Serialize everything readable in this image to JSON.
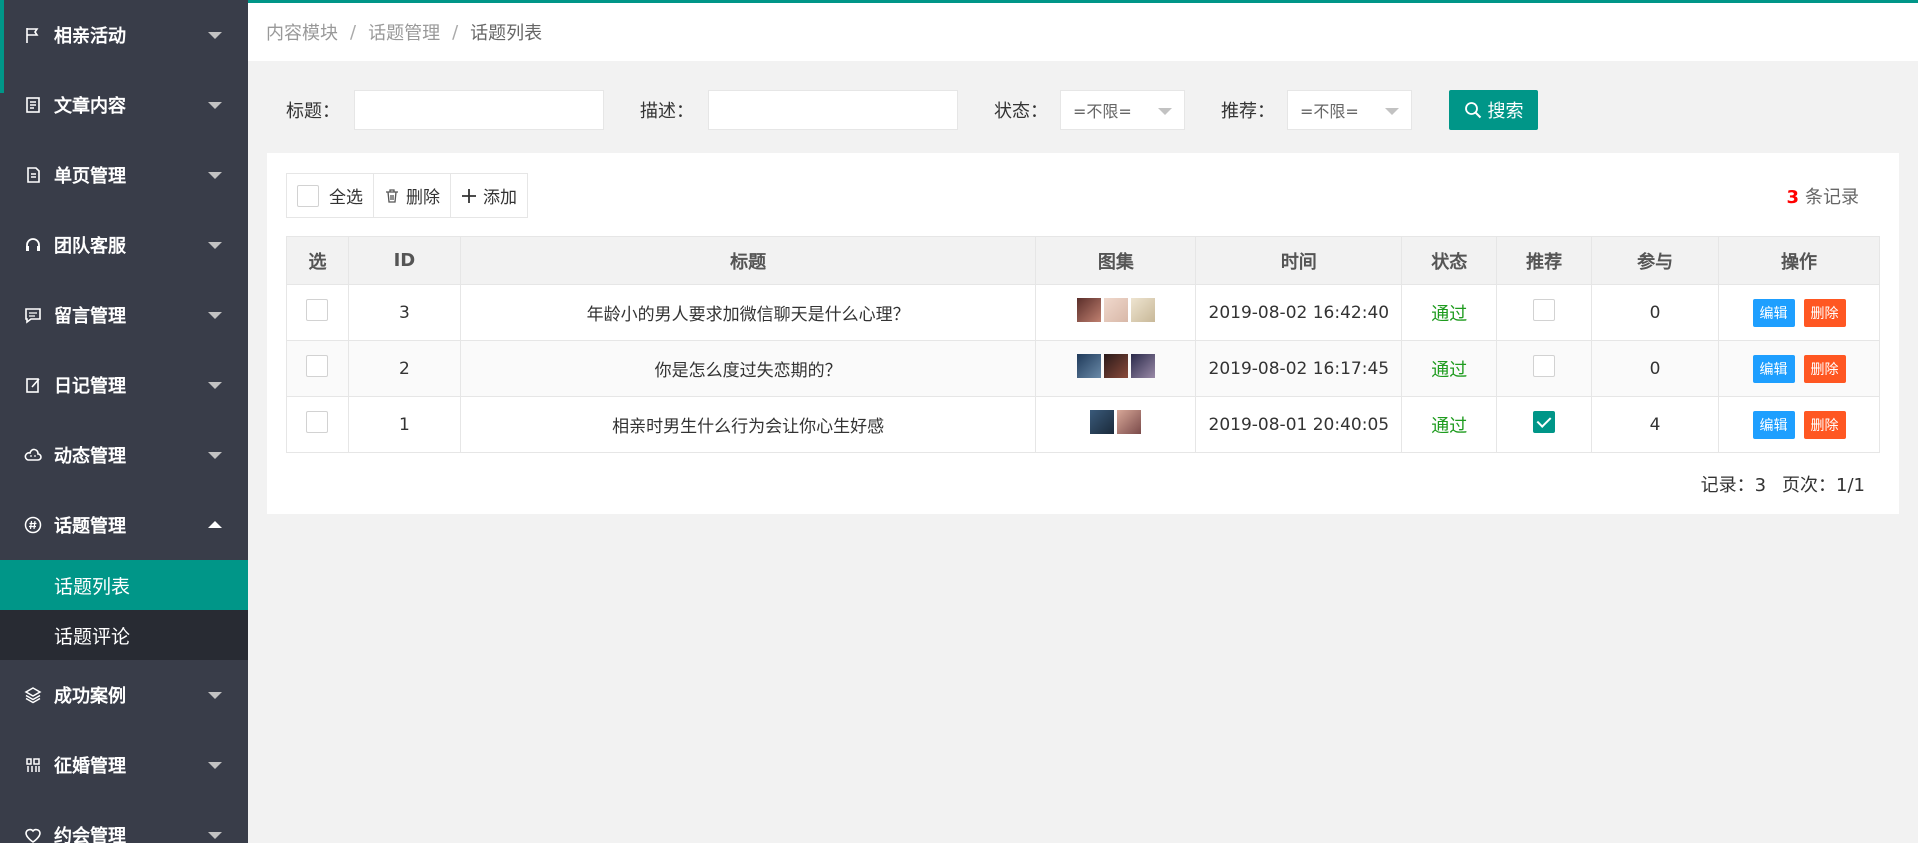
{
  "sidebar": {
    "items": [
      {
        "label": "相亲活动",
        "icon": "flag-icon"
      },
      {
        "label": "文章内容",
        "icon": "document-icon"
      },
      {
        "label": "单页管理",
        "icon": "page-icon"
      },
      {
        "label": "团队客服",
        "icon": "headset-icon"
      },
      {
        "label": "留言管理",
        "icon": "message-icon"
      },
      {
        "label": "日记管理",
        "icon": "edit-note-icon"
      },
      {
        "label": "动态管理",
        "icon": "cloud-icon"
      },
      {
        "label": "话题管理",
        "icon": "hashtag-icon"
      },
      {
        "label": "成功案例",
        "icon": "layers-icon"
      },
      {
        "label": "征婚管理",
        "icon": "grid-icon"
      },
      {
        "label": "约会管理",
        "icon": "heart-icon"
      }
    ],
    "sub_items": [
      {
        "label": "话题列表",
        "active": true
      },
      {
        "label": "话题评论",
        "active": false
      }
    ]
  },
  "breadcrumb": {
    "items": [
      "内容模块",
      "话题管理",
      "话题列表"
    ],
    "separator": "/"
  },
  "filters": {
    "title_label": "标题：",
    "desc_label": "描述：",
    "status_label": "状态：",
    "status_value": "=不限=",
    "recommend_label": "推荐：",
    "recommend_value": "=不限=",
    "search_label": "搜索"
  },
  "toolbar": {
    "select_all": "全选",
    "delete": "删除",
    "add": "添加",
    "count": "3",
    "count_suffix": "条记录"
  },
  "table": {
    "headers": [
      "选",
      "ID",
      "标题",
      "图集",
      "时间",
      "状态",
      "推荐",
      "参与",
      "操作"
    ],
    "rows": [
      {
        "id": "3",
        "title": "年龄小的男人要求加微信聊天是什么心理？",
        "images": 3,
        "time": "2019-08-02 16:42:40",
        "status": "通过",
        "recommend": false,
        "participants": "0",
        "edit": "编辑",
        "delete": "删除"
      },
      {
        "id": "2",
        "title": "你是怎么度过失恋期的？",
        "images": 3,
        "time": "2019-08-02 16:17:45",
        "status": "通过",
        "recommend": false,
        "participants": "0",
        "edit": "编辑",
        "delete": "删除"
      },
      {
        "id": "1",
        "title": "相亲时男生什么行为会让你心生好感",
        "images": 2,
        "time": "2019-08-01 20:40:05",
        "status": "通过",
        "recommend": true,
        "participants": "4",
        "edit": "编辑",
        "delete": "删除"
      }
    ]
  },
  "pager": {
    "records": "记录：3",
    "pages": "页次：1/1"
  },
  "colors": {
    "accent": "#009688",
    "sidebar_bg": "#393d49",
    "edit_btn": "#1e9fff",
    "delete_btn": "#ff5722",
    "status_pass": "#1e9b1e"
  }
}
